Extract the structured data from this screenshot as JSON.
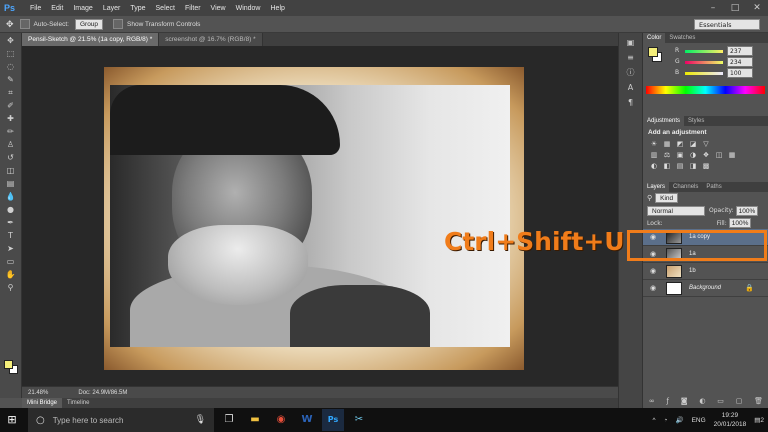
{
  "app": {
    "logo": "Ps",
    "menus": [
      "File",
      "Edit",
      "Image",
      "Layer",
      "Type",
      "Select",
      "Filter",
      "View",
      "Window",
      "Help"
    ],
    "window_controls": [
      "–",
      "□",
      "✕"
    ]
  },
  "options": {
    "auto_select_label": "Auto-Select:",
    "auto_select_value": "Group",
    "show_transform_label": "Show Transform Controls",
    "workspace": "Essentials"
  },
  "tabs": [
    {
      "label": "Pensil-Sketch @ 21.5% (1a copy, RGB/8) *",
      "active": true
    },
    {
      "label": "screenshot @ 16.7% (RGB/8) *",
      "active": false
    }
  ],
  "status": {
    "zoom": "21.48%",
    "doc": "Doc: 24.9M/86.5M"
  },
  "bottom_tabs": [
    "Mini Bridge",
    "Timeline"
  ],
  "color_panel": {
    "tabs": [
      "Color",
      "Swatches"
    ],
    "fg_color": "#f4ee7a",
    "sliders": [
      {
        "letter": "R",
        "value": "237",
        "gradient": "linear-gradient(90deg,#00ee64,#ffee64)"
      },
      {
        "letter": "G",
        "value": "234",
        "gradient": "linear-gradient(90deg,#ed0064,#edff64)"
      },
      {
        "letter": "B",
        "value": "100",
        "gradient": "linear-gradient(90deg,#edea00,#edeaff)"
      }
    ]
  },
  "adjustments": {
    "tabs": [
      "Adjustments",
      "Styles"
    ],
    "title": "Add an adjustment",
    "row1": [
      "☀",
      "▦",
      "◩",
      "◪",
      "▽"
    ],
    "row2": [
      "▥",
      "⚖",
      "▣",
      "◑",
      "❖",
      "◫",
      "▦"
    ],
    "row3": [
      "◐",
      "◧",
      "▤",
      "◨",
      "▩"
    ]
  },
  "layers": {
    "tabs": [
      "Layers",
      "Channels",
      "Paths"
    ],
    "kind_label": "Kind",
    "blend_mode": "Normal",
    "opacity_label": "Opacity:",
    "opacity": "100%",
    "lock_label": "Lock:",
    "fill_label": "Fill:",
    "fill": "100%",
    "items": [
      {
        "name": "1a copy",
        "selected": true,
        "thumb": "linear-gradient(135deg,#222,#999)",
        "italic": false,
        "locked": false
      },
      {
        "name": "1a",
        "selected": false,
        "thumb": "linear-gradient(135deg,#555,#ccc)",
        "italic": false,
        "locked": false
      },
      {
        "name": "1b",
        "selected": false,
        "thumb": "linear-gradient(135deg,#c8a070,#f0e0c0)",
        "italic": false,
        "locked": false
      },
      {
        "name": "Background",
        "selected": false,
        "thumb": "#ffffff",
        "italic": true,
        "locked": true
      }
    ]
  },
  "annotation": {
    "shortcut": "Ctrl+Shift+U",
    "color": "#f07c1a"
  },
  "taskbar": {
    "search_placeholder": "Type here to search",
    "language": "ENG",
    "time": "19:29",
    "date": "20/01/2018",
    "notification_count": "2"
  }
}
